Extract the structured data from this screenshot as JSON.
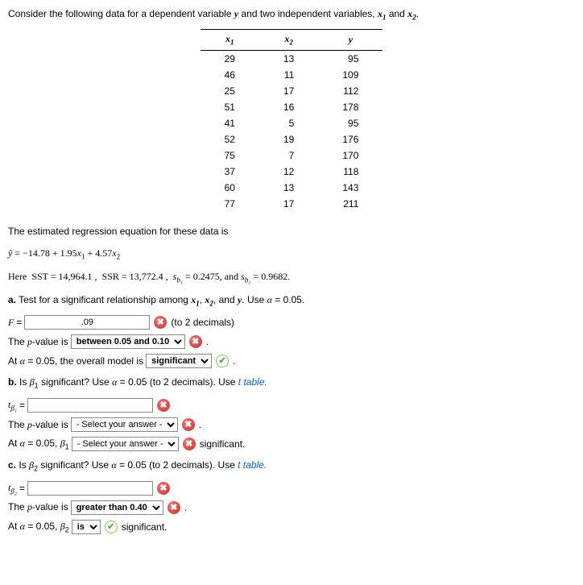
{
  "intro": "Consider the following data for a dependent variable y and two independent variables, x₁ and x₂.",
  "table": {
    "headers": [
      "x₁",
      "x₂",
      "y"
    ],
    "rows": [
      [
        "29",
        "13",
        "95"
      ],
      [
        "46",
        "11",
        "109"
      ],
      [
        "25",
        "17",
        "112"
      ],
      [
        "51",
        "16",
        "178"
      ],
      [
        "41",
        "5",
        "95"
      ],
      [
        "52",
        "19",
        "176"
      ],
      [
        "75",
        "7",
        "170"
      ],
      [
        "37",
        "12",
        "118"
      ],
      [
        "60",
        "13",
        "143"
      ],
      [
        "77",
        "17",
        "211"
      ]
    ]
  },
  "eq_intro": "The estimated regression equation for these data is",
  "equation": "ŷ = −14.78 + 1.95x₁ + 4.57x₂",
  "stats_line_pre": "Here ",
  "SST_label": "SST = ",
  "SST": "14,964.1",
  "SSR_label": "SSR = ",
  "SSR": "13,772.4",
  "sb1": "0.2475",
  "sb2": "0.9682",
  "partA": "a. Test for a significant relationship among x₁, x₂, and y. Use α = 0.05.",
  "F_label": "F =",
  "F_val": ".09",
  "F_hint": "(to 2 decimals)",
  "pval_prefix": "The p-value is",
  "pvalA": "between 0.05 and 0.10",
  "modelA_pre": "At α = 0.05, the overall model is",
  "modelA_val": "significant",
  "partB": "b. Is β₁ significant? Use α = 0.05 (to 2 decimals). Use ",
  "ttable": "t table.",
  "tb1_label": "t_β₁ =",
  "pvalB": "- Select your answer -",
  "b1_pre": "At α = 0.05, β₁",
  "b1_sel": "- Select your answer -",
  "b1_post": "significant.",
  "partC": "c. Is β₂ significant? Use α = 0.05 (to 2 decimals). Use ",
  "tb2_label": "t_β₂ =",
  "pvalC": "greater than 0.40",
  "b2_pre": "At α = 0.05, β₂",
  "b2_sel": "is",
  "b2_post": "significant.",
  "period": "."
}
